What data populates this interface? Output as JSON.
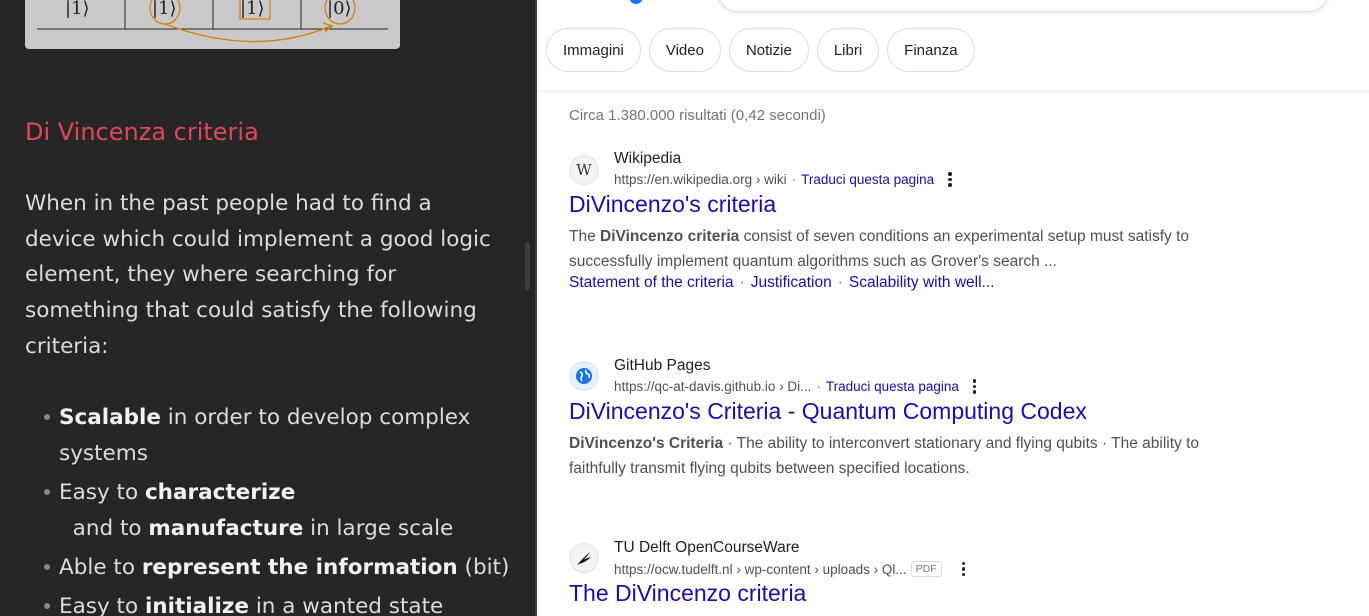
{
  "notes": {
    "figure": {
      "kets": [
        "|1⟩",
        "|1⟩",
        "|1⟩",
        "|0⟩"
      ]
    },
    "heading": "Di Vincenza criteria",
    "intro": "When in the past people had to find a device which could implement a good logic element, they where searching for something that could satisfy the following criteria:",
    "criteria": [
      {
        "bold": "Scalable",
        "rest": " in order to develop complex systems"
      },
      {
        "pre": "Easy to ",
        "bold": "characterize",
        "mid": "  and to ",
        "bold2": "manufacture",
        "rest": " in large scale"
      },
      {
        "pre": "Able to ",
        "bold": "represent the information",
        "rest": " (bit)"
      },
      {
        "pre": "Easy to ",
        "bold": "initialize",
        "rest": " in a wanted state"
      }
    ]
  },
  "search": {
    "chips": [
      "Immagini",
      "Video",
      "Notizie",
      "Libri",
      "Finanza"
    ],
    "stats": "Circa 1.380.000 risultati (0,42 secondi)",
    "results": [
      {
        "site": "Wikipedia",
        "url": "https://en.wikipedia.org › wiki",
        "translate": "Traduci questa pagina",
        "title": "DiVincenzo's criteria",
        "snippet_pre": "The ",
        "snippet_bold": "DiVincenzo criteria",
        "snippet_rest": " consist of seven conditions an experimental setup must satisfy to successfully implement quantum algorithms such as Grover's search ...",
        "sitelinks": [
          "Statement of the criteria",
          "Justification",
          "Scalability with well..."
        ],
        "icon": "wikipedia-w-icon"
      },
      {
        "site": "GitHub Pages",
        "url": "https://qc-at-davis.github.io › Di...",
        "translate": "Traduci questa pagina",
        "title": "DiVincenzo's Criteria - Quantum Computing Codex",
        "snippet_bold": "DiVincenzo's Criteria",
        "snippet_rest": " · The ability to interconvert stationary and flying qubits · The ability to faithfully transmit flying qubits between specified locations.",
        "icon": "globe-icon"
      },
      {
        "site": "TU Delft OpenCourseWare",
        "url": "https://ocw.tudelft.nl › wp-content › uploads › Ql...",
        "badge": "PDF",
        "title": "The DiVincenzo criteria",
        "icon": "tudelft-flame-icon"
      }
    ]
  },
  "colors": {
    "notes_bg": "#262626",
    "heading": "#e04858",
    "link": "#1a0dab"
  }
}
